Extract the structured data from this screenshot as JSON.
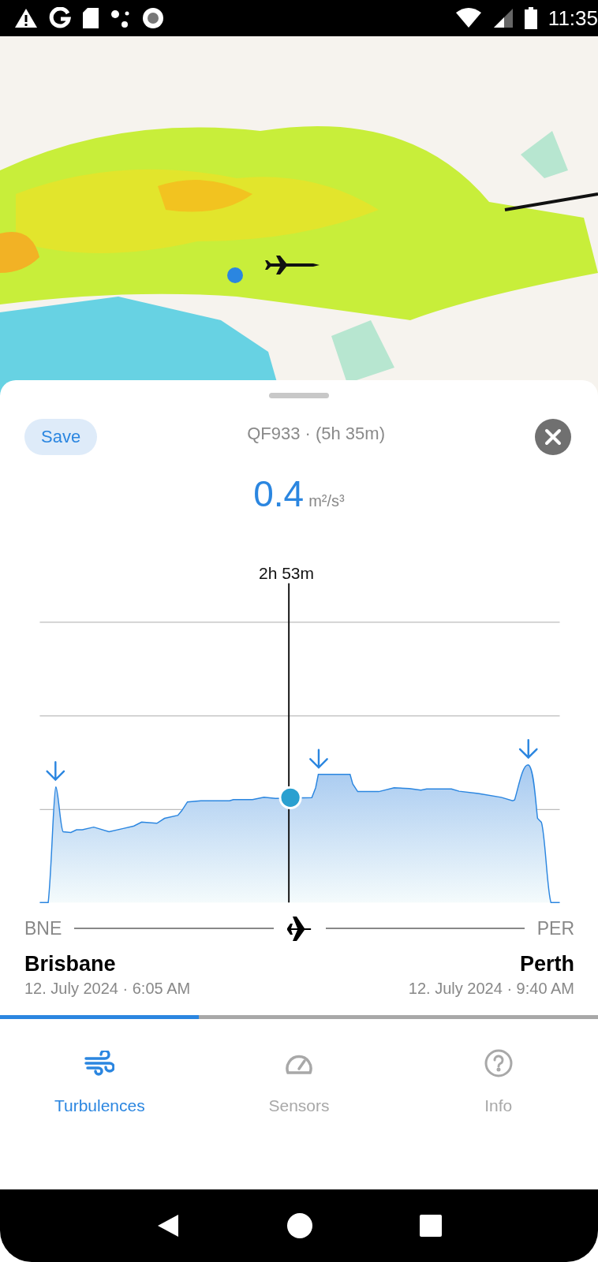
{
  "status_bar": {
    "time": "11:35"
  },
  "sheet": {
    "save_button": "Save",
    "title": "QF933 · (5h 35m)",
    "value": "0.4",
    "unit": "m²/s³",
    "chart": {
      "cursor_label": "2h 53m"
    },
    "route": {
      "origin_code": "BNE",
      "destination_code": "PER",
      "origin": {
        "city": "Brisbane",
        "time": "12. July 2024 · 6:05 AM"
      },
      "destination": {
        "city": "Perth",
        "time": "12. July 2024 · 9:40 AM"
      }
    },
    "progress": {
      "level": 0.333
    }
  },
  "tabs": [
    {
      "label": "Turbulences",
      "selected": true
    },
    {
      "label": "Sensors",
      "selected": false
    },
    {
      "label": "Info",
      "selected": false
    }
  ]
}
